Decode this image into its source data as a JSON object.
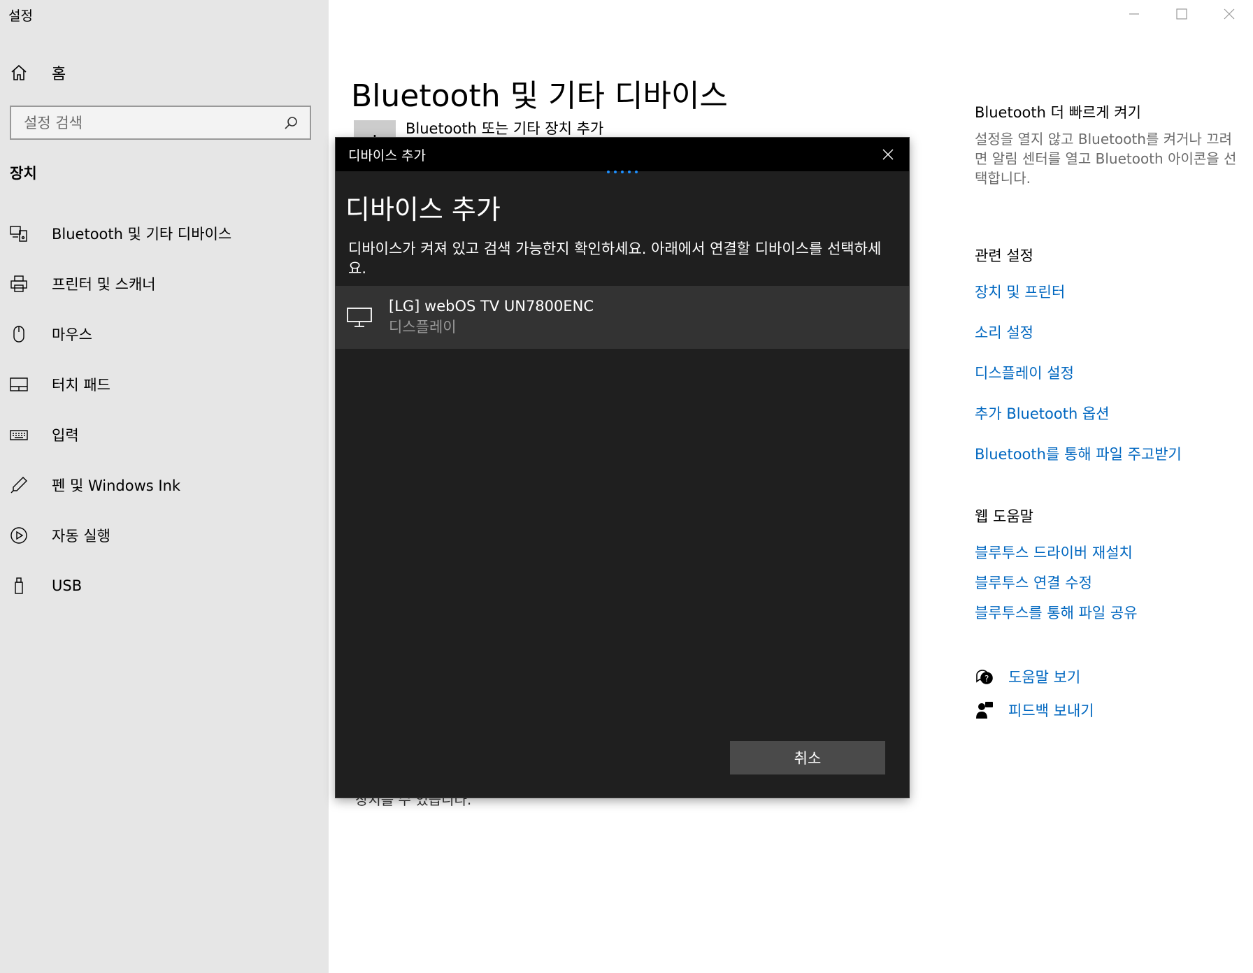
{
  "app": {
    "title": "설정"
  },
  "sidebar": {
    "home_label": "홈",
    "search_placeholder": "설정 검색",
    "section": "장치",
    "items": [
      {
        "label": "Bluetooth 및 기타 디바이스",
        "icon": "bluetooth-devices-icon"
      },
      {
        "label": "프린터 및 스캐너",
        "icon": "printer-icon"
      },
      {
        "label": "마우스",
        "icon": "mouse-icon"
      },
      {
        "label": "터치 패드",
        "icon": "touchpad-icon"
      },
      {
        "label": "입력",
        "icon": "keyboard-icon"
      },
      {
        "label": "펜 및 Windows Ink",
        "icon": "pen-icon"
      },
      {
        "label": "자동 실행",
        "icon": "autoplay-icon"
      },
      {
        "label": "USB",
        "icon": "usb-icon"
      }
    ]
  },
  "main": {
    "title": "Bluetooth 및 기타 디바이스",
    "add_device_label": "Bluetooth 또는 기타 장치 추가",
    "add_device_tile": "+",
    "behind_text": "장치를 수 있습니다."
  },
  "right_panel": {
    "quick_heading": "Bluetooth 더 빠르게 켜기",
    "quick_text": "설정을 열지 않고 Bluetooth를 켜거나 끄려면 알림 센터를 열고 Bluetooth 아이콘을 선택합니다.",
    "related_heading": "관련 설정",
    "related_links": [
      "장치 및 프린터",
      "소리 설정",
      "디스플레이 설정",
      "추가 Bluetooth 옵션",
      "Bluetooth를 통해 파일 주고받기"
    ],
    "web_help_heading": "웹 도움말",
    "web_help_links": [
      "블루투스 드라이버 재설치",
      "블루투스 연결 수정",
      "블루투스를 통해 파일 공유"
    ],
    "help_link": "도움말 보기",
    "feedback_link": "피드백 보내기"
  },
  "dialog": {
    "window_title": "디바이스 추가",
    "heading": "디바이스 추가",
    "description": "디바이스가 켜져 있고 검색 가능한지 확인하세요. 아래에서 연결할 디바이스를 선택하세요.",
    "device": {
      "name": "[LG] webOS TV UN7800ENC",
      "type": "디스플레이",
      "icon": "monitor-icon"
    },
    "cancel_label": "취소"
  },
  "colors": {
    "link": "#0067c0",
    "sidebar_bg": "#e6e6e6",
    "dialog_bg": "#1f1f1f",
    "progress": "#1e90ff"
  }
}
